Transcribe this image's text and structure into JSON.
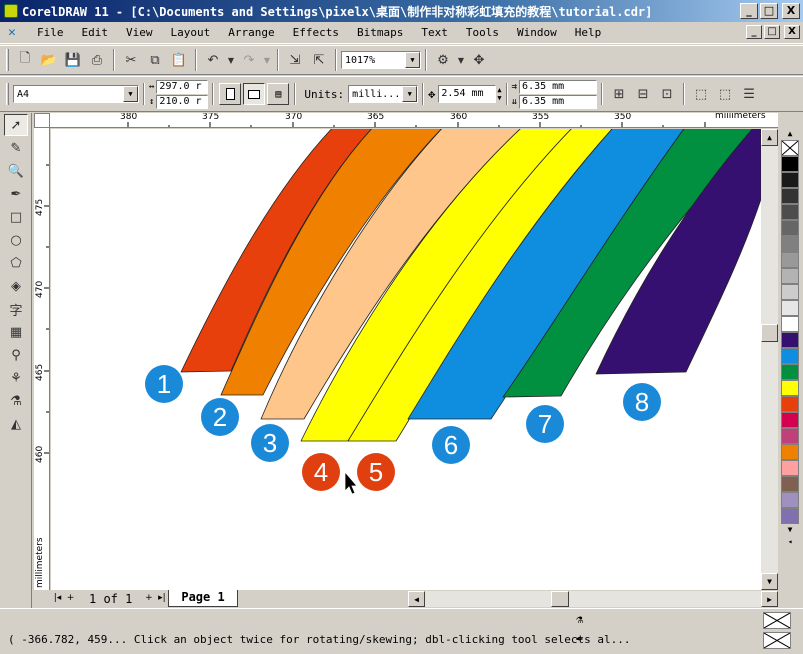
{
  "window": {
    "title": "CorelDRAW 11 - [C:\\Documents and Settings\\pixelx\\桌面\\制作非对称彩虹填充的教程\\tutorial.cdr]",
    "minimize": "_",
    "maximize": "□",
    "close": "X"
  },
  "menu": {
    "items": [
      "File",
      "Edit",
      "View",
      "Layout",
      "Arrange",
      "Effects",
      "Bitmaps",
      "Text",
      "Tools",
      "Window",
      "Help"
    ]
  },
  "standard_toolbar": {
    "zoom_level": "1017%"
  },
  "property_bar": {
    "paper_size": "A4",
    "width_value": "297.0 r",
    "height_value": "210.0 r",
    "units_label": "Units:",
    "units_value": "milli...",
    "nudge_value": "2.54 mm",
    "dup_x_value": "6.35 mm",
    "dup_y_value": "6.35 mm"
  },
  "rulers": {
    "horizontal_ticks": [
      "380",
      "375",
      "370",
      "365",
      "360",
      "355",
      "350"
    ],
    "horizontal_unit": "millimeters",
    "vertical_ticks": [
      "475",
      "470",
      "465",
      "460"
    ],
    "vertical_unit": "millimeters"
  },
  "drawing": {
    "stripe_colors": [
      "#e8400c",
      "#f08000",
      "#ffc68c",
      "#ffff00",
      "#ffff00",
      "#0f8ee0",
      "#009040",
      "#361070"
    ],
    "marker_colors": [
      "#1a8ad8",
      "#1a8ad8",
      "#1a8ad8",
      "#e04010",
      "#e04010",
      "#1a8ad8",
      "#1a8ad8",
      "#1a8ad8"
    ],
    "markers": [
      "1",
      "2",
      "3",
      "4",
      "5",
      "6",
      "7",
      "8"
    ]
  },
  "palette": {
    "colors": [
      "#000000",
      "#1a1a1a",
      "#333333",
      "#4d4d4d",
      "#666666",
      "#808080",
      "#999999",
      "#b3b3b3",
      "#cccccc",
      "#e6e6e6",
      "#ffffff",
      "#361070",
      "#0f8ee0",
      "#009040",
      "#ffff00",
      "#e8400c",
      "#d40050",
      "#c0407a",
      "#f08000",
      "#ffa0a0",
      "#806050",
      "#a090c0",
      "#8070b0"
    ]
  },
  "document_nav": {
    "page_count": "1 of 1",
    "page_tab": "Page 1"
  },
  "status": {
    "text": "( -366.782, 459... Click an object twice for rotating/skewing; dbl-clicking tool selects al..."
  }
}
